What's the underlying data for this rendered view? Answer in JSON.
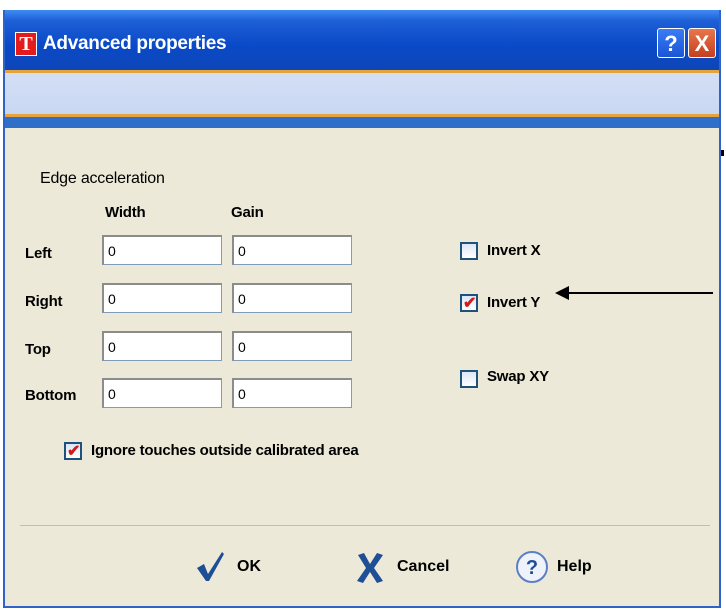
{
  "window": {
    "title": "Advanced properties",
    "app_icon_letter": "T"
  },
  "titlebar": {
    "help_glyph": "?",
    "close_glyph": "X"
  },
  "section": {
    "title": "Edge acceleration"
  },
  "columns": {
    "width": "Width",
    "gain": "Gain"
  },
  "rows": [
    {
      "label": "Left",
      "width": "0",
      "gain": "0"
    },
    {
      "label": "Right",
      "width": "0",
      "gain": "0"
    },
    {
      "label": "Top",
      "width": "0",
      "gain": "0"
    },
    {
      "label": "Bottom",
      "width": "0",
      "gain": "0"
    }
  ],
  "options": {
    "invert_x": {
      "label": "Invert X",
      "checked": false
    },
    "invert_y": {
      "label": "Invert Y",
      "checked": true
    },
    "swap_xy": {
      "label": "Swap XY",
      "checked": false
    },
    "ignore_touches": {
      "label": "Ignore touches outside calibrated area",
      "checked": true
    }
  },
  "buttons": {
    "ok": "OK",
    "cancel": "Cancel",
    "help": "Help"
  },
  "icons": {
    "ok": "checkmark-icon",
    "cancel": "x-icon",
    "help": "question-icon"
  },
  "colors": {
    "titlebar": "#0a49c7",
    "accent": "#e6a23b",
    "check": "#d11a1a"
  }
}
